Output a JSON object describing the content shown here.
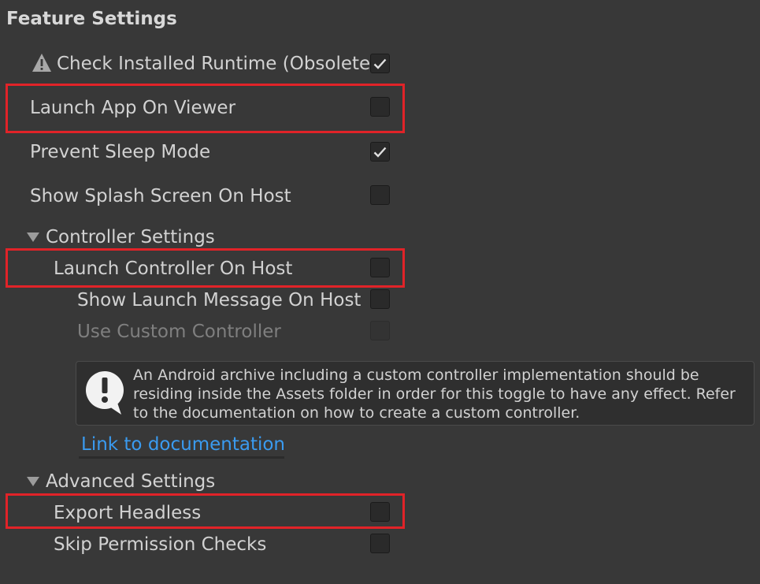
{
  "section_title": "Feature Settings",
  "rows": [
    {
      "label": "Check Installed Runtime (Obsolete)",
      "checked": true
    },
    {
      "label": "Launch App On Viewer",
      "checked": false
    },
    {
      "label": "Prevent Sleep Mode",
      "checked": true
    },
    {
      "label": "Show Splash Screen On Host",
      "checked": false
    }
  ],
  "controller_settings": {
    "title": "Controller Settings",
    "rows": [
      {
        "label": "Launch Controller On Host",
        "checked": false
      },
      {
        "label": "Show Launch Message On Host",
        "checked": false
      },
      {
        "label": "Use Custom Controller",
        "checked": false,
        "disabled": true
      }
    ],
    "help_text": "An Android archive including a custom controller implementation should be residing inside the Assets folder in order for this toggle to have any effect. Refer to the documentation on how to create a custom controller.",
    "link_text": "Link to documentation"
  },
  "advanced_settings": {
    "title": "Advanced Settings",
    "rows": [
      {
        "label": "Export Headless",
        "checked": false
      },
      {
        "label": "Skip Permission Checks",
        "checked": false
      }
    ]
  },
  "colors": {
    "background": "#383838",
    "highlight": "#e12328",
    "link": "#3a9bf0"
  }
}
